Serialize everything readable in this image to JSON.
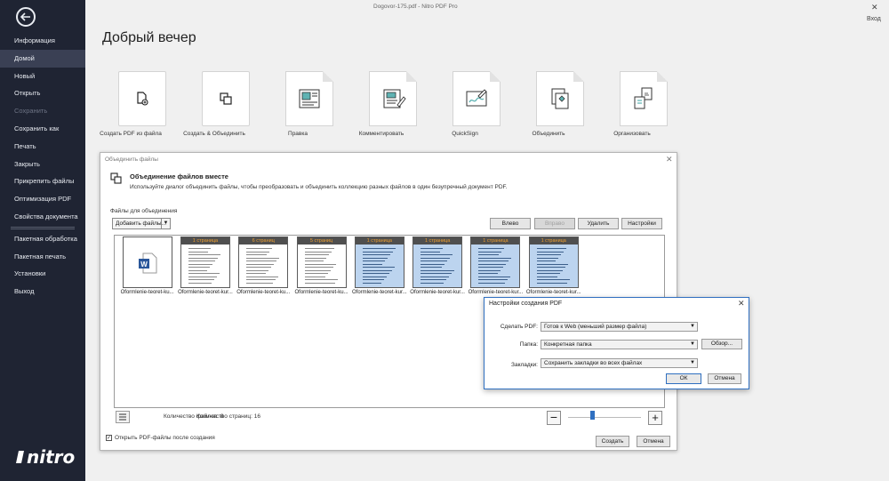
{
  "window": {
    "title": "Dogovor-175.pdf - Nitro PDF Pro",
    "login": "Вход",
    "close": "✕"
  },
  "sidebar": {
    "logo": "nitro",
    "items": [
      {
        "label": "Информация",
        "state": "normal"
      },
      {
        "label": "Домой",
        "state": "active"
      },
      {
        "label": "Новый",
        "state": "normal"
      },
      {
        "label": "Открыть",
        "state": "normal"
      },
      {
        "label": "Сохранить",
        "state": "disabled"
      },
      {
        "label": "Сохранить как",
        "state": "normal"
      },
      {
        "label": "Печать",
        "state": "normal"
      },
      {
        "label": "Закрыть",
        "state": "normal"
      },
      {
        "label": "Прикрепить файлы",
        "state": "normal"
      },
      {
        "label": "Оптимизация PDF",
        "state": "normal"
      },
      {
        "label": "Свойства документа",
        "state": "normal"
      },
      {
        "label": "Пакетная обработка",
        "state": "normal"
      },
      {
        "label": "Пакетная печать",
        "state": "normal"
      },
      {
        "label": "Установки",
        "state": "normal"
      },
      {
        "label": "Выход",
        "state": "normal"
      }
    ]
  },
  "home": {
    "greeting": "Добрый вечер",
    "tiles": [
      {
        "label": "Создать PDF из файла",
        "icon": "create-pdf-icon"
      },
      {
        "label": "Создать & Объединить",
        "icon": "create-combine-icon"
      },
      {
        "label": "Правка",
        "icon": "edit-icon"
      },
      {
        "label": "Комментировать",
        "icon": "comment-icon"
      },
      {
        "label": "QuickSign",
        "icon": "quicksign-icon"
      },
      {
        "label": "Объединить",
        "icon": "combine-icon"
      },
      {
        "label": "Организовать",
        "icon": "organize-icon"
      }
    ]
  },
  "combine_dialog": {
    "title": "Объединить файлы",
    "heading": "Объединение файлов вместе",
    "description": "Используйте диалог объединить файлы, чтобы преобразовать и объединить коллекцию разных файлов в один безупречный документ PDF.",
    "files_label": "Файлы для объединения",
    "add_files": "Добавить файлы...",
    "buttons": {
      "left": "Влево",
      "right": "Вправо",
      "delete": "Удалить",
      "settings": "Настройки"
    },
    "files": [
      {
        "name": "Oformlenie-teoret-ku...",
        "badge": "",
        "type": "word"
      },
      {
        "name": "Oformlenie-teoret-kur...",
        "badge": "1 страница",
        "type": "doc"
      },
      {
        "name": "Oformlenie-teoret-ku...",
        "badge": "6 страниц",
        "type": "doc"
      },
      {
        "name": "Oformlenie-teoret-ku...",
        "badge": "5 страниц",
        "type": "doc"
      },
      {
        "name": "Oformlenie-teoret-kur...",
        "badge": "1 страница",
        "type": "scan"
      },
      {
        "name": "Oformlenie-teoret-kur...",
        "badge": "1 страница",
        "type": "scan"
      },
      {
        "name": "Oformlenie-teoret-kur...",
        "badge": "1 страница",
        "type": "scan"
      },
      {
        "name": "Oformlenie-teoret-kur...",
        "badge": "1 страница",
        "type": "scan"
      }
    ],
    "count_files": "Количество файлов: 8",
    "count_pages": "Количество страниц: 16",
    "open_after": "Открыть PDF-файлы после создания",
    "open_after_checked": true,
    "create": "Создать",
    "cancel": "Отмена",
    "zoom_level": 0.3
  },
  "settings_dialog": {
    "title": "Настройки создания PDF",
    "make_label": "Сделать PDF:",
    "make_value": "Готов к Web (меньший размер файла)",
    "folder_label": "Папка:",
    "folder_value": "Конкретная папка",
    "browse": "Обзор...",
    "bookmarks_label": "Закладки:",
    "bookmarks_value": "Сохранить закладки во всех файлах",
    "ok": "ОК",
    "cancel": "Отмена"
  },
  "colors": {
    "sidebar": "#1f2433",
    "accent": "#2f6fc0",
    "badge_text": "#f0a030",
    "scan_bg": "#bcd4ef"
  }
}
